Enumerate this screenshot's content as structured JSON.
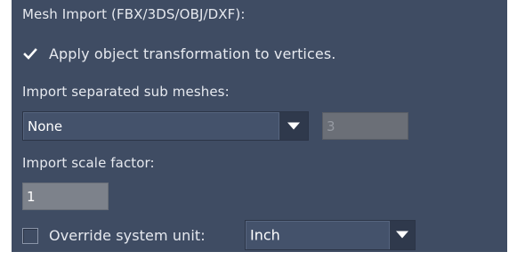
{
  "mesh_import": {
    "heading": "Mesh Import (FBX/3DS/OBJ/DXF):",
    "apply_transform": {
      "label": "Apply object transformation to vertices.",
      "checked": true
    },
    "separated_sub_meshes": {
      "label": "Import separated sub meshes:",
      "selected": "None",
      "count_value": "3"
    },
    "scale_factor": {
      "label": "Import scale factor:",
      "value": "1"
    },
    "override_unit": {
      "label": "Override system unit:",
      "checked": false,
      "selected": "Inch"
    }
  },
  "icons": {
    "checkmark": "checkmark-icon",
    "dropdown_arrow": "chevron-down-icon"
  },
  "colors": {
    "panel_background": "#3f4c63",
    "text": "#e6e9ef",
    "disabled_input": "#6b6f77",
    "enabled_input": "#7d828b"
  }
}
